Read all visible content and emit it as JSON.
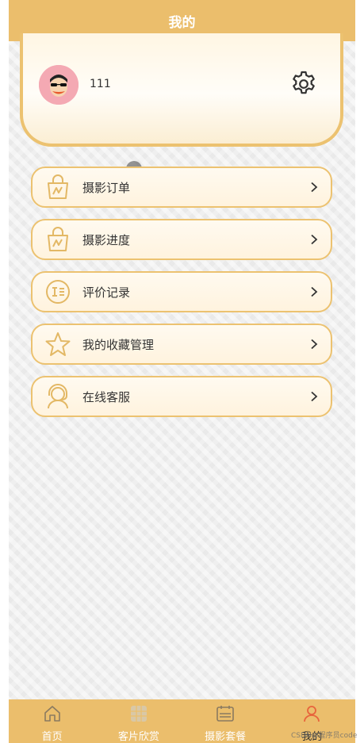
{
  "header": {
    "title": "我的"
  },
  "profile": {
    "username": "111"
  },
  "menu": [
    {
      "label": "摄影订单"
    },
    {
      "label": "摄影进度"
    },
    {
      "label": "评价记录"
    },
    {
      "label": "我的收藏管理"
    },
    {
      "label": "在线客服"
    }
  ],
  "tabbar": {
    "tabs": [
      {
        "label": "首页"
      },
      {
        "label": "客片欣赏"
      },
      {
        "label": "摄影套餐"
      },
      {
        "label": "我的"
      }
    ],
    "active": "我的"
  },
  "watermark": "CSDN@程序员code",
  "colors": {
    "accent": "#ebbe6c",
    "border": "#ecc270",
    "icon": "#e3b865",
    "active_tab": "#e8643c"
  }
}
